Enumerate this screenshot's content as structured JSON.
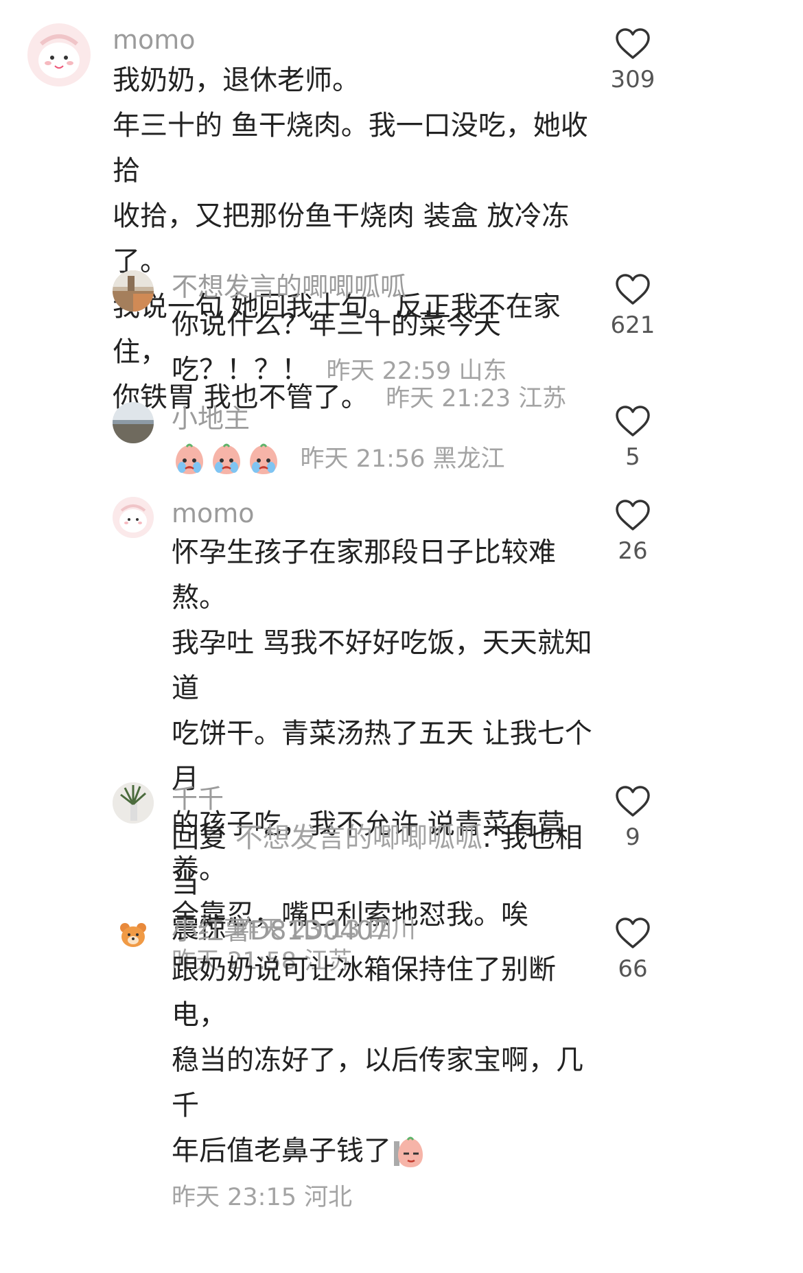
{
  "comments": [
    {
      "user": "momo",
      "lines": [
        "我奶奶，退休老师。",
        "年三十的 鱼干烧肉。我一口没吃，她收拾",
        "收拾，又把那份鱼干烧肉 装盒 放冷冻了。",
        "我说一句 她回我十句。反正我不在家住，",
        "你铁胃 我也不管了。"
      ],
      "meta": "昨天 21:23 江苏",
      "likes": "309"
    },
    {
      "user": "不想发言的唧唧呱呱",
      "lines": [
        "你说什么？年三十的菜今天",
        "吃？！？！"
      ],
      "meta": "昨天 22:59 山东",
      "likes": "621"
    },
    {
      "user": "小地主",
      "lines": [
        ""
      ],
      "meta": "昨天 21:56 黑龙江",
      "likes": "5",
      "emojis": [
        "crying-peach-emoji",
        "crying-peach-emoji",
        "crying-peach-emoji"
      ]
    },
    {
      "user": "momo",
      "lines": [
        "怀孕生孩子在家那段日子比较难熬。",
        "我孕吐 骂我不好好吃饭，天天就知道",
        "吃饼干。青菜汤热了五天 让我七个月",
        "的孩子吃，我不允许 说青菜有营养。",
        "全靠忍，嘴巴利索地怼我。唉"
      ],
      "meta": "昨天 21:58 江苏",
      "likes": "26"
    },
    {
      "user": "千千",
      "reply_prefix": "回复",
      "reply_to": "不想发言的唧唧呱呱",
      "lines": [
        "我也相当",
        "震惊"
      ],
      "meta": "昨天 23:13 四川",
      "likes": "9"
    },
    {
      "user": "小红薯D81D0407",
      "lines": [
        "跟奶奶说可让冰箱保持住了别断电，",
        "稳当的冻好了，以后传家宝啊，几千",
        "年后值老鼻子钱了"
      ],
      "meta": "昨天 23:15 河北",
      "likes": "66",
      "emojis": [
        "smirk-peach-emoji"
      ]
    }
  ],
  "colors": {
    "name": "#9b9b9b",
    "text": "#222222",
    "meta": "#a3a3a3"
  },
  "icons": {
    "like": "heart-outline-icon"
  }
}
